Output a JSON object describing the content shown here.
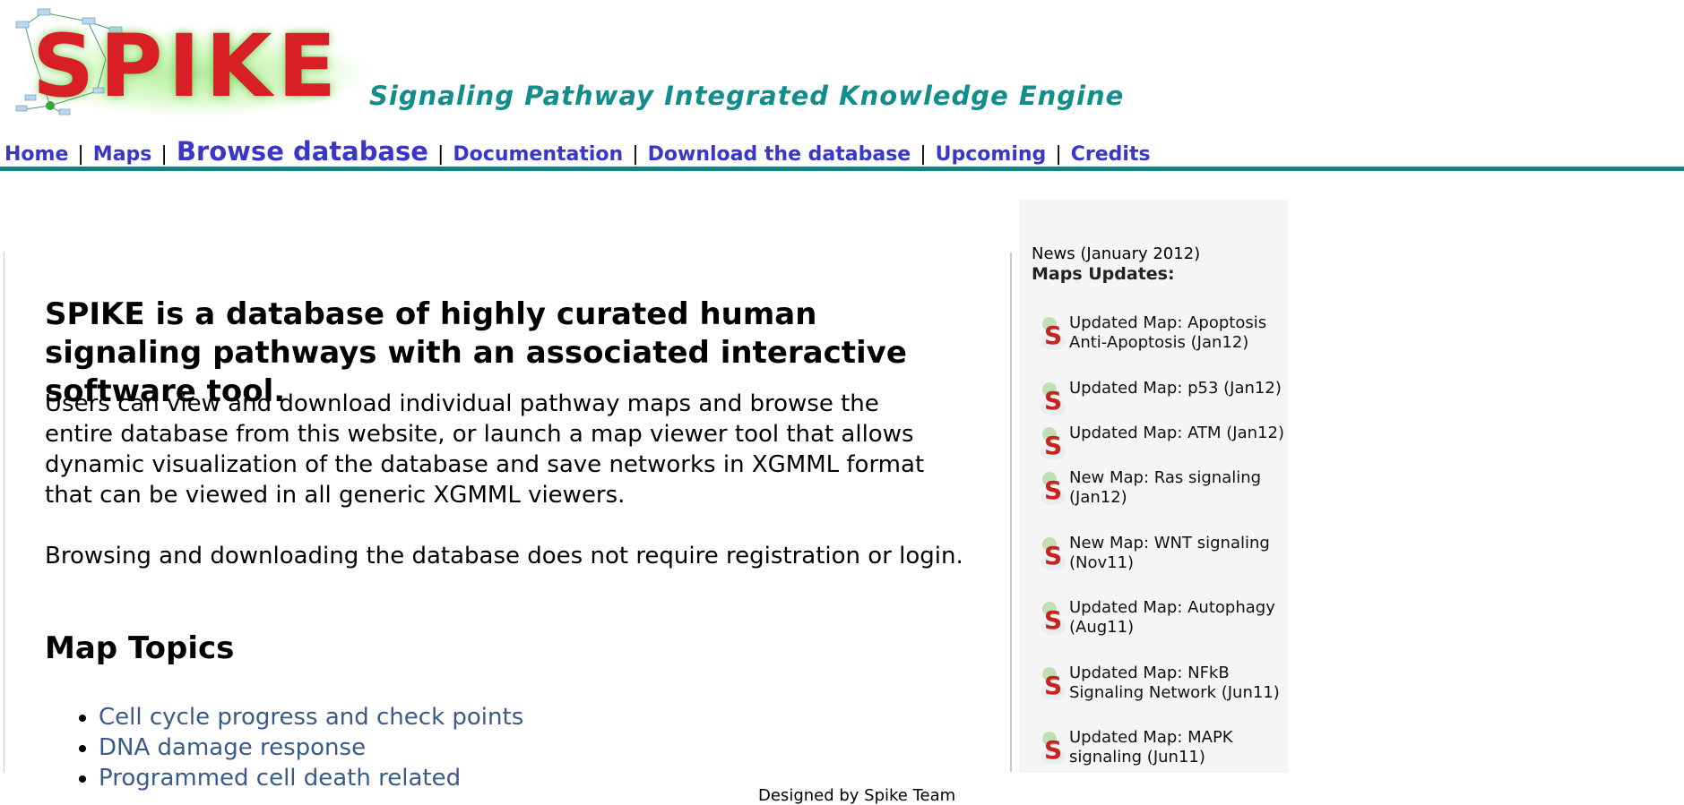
{
  "header": {
    "logo_text": "SPIKE",
    "tagline": "Signaling Pathway Integrated Knowledge Engine"
  },
  "nav": {
    "separator": "|",
    "items": [
      {
        "label": "Home"
      },
      {
        "label": "Maps"
      },
      {
        "label": "Browse database"
      },
      {
        "label": "Documentation"
      },
      {
        "label": "Download the database"
      },
      {
        "label": "Upcoming"
      },
      {
        "label": "Credits"
      }
    ]
  },
  "main": {
    "headline": "SPIKE is a database of highly curated human signaling pathways with an associated interactive software tool.",
    "intro": "Users can view and download individual pathway maps and browse the entire database from this website, or launch a map viewer tool that allows dynamic visualization of the database and save networks in XGMML format that can be viewed in all generic XGMML viewers.",
    "note": "Browsing and downloading the database does not require registration or login.",
    "topics_title": "Map Topics",
    "topics": [
      {
        "label": "Cell cycle progress and check points"
      },
      {
        "label": "DNA damage response"
      },
      {
        "label": "Programmed cell death related"
      }
    ]
  },
  "news": {
    "date_label": "News (January 2012)",
    "title": "Maps Updates:",
    "items": [
      {
        "text": "Updated Map: Apoptosis Anti-Apoptosis (Jan12)"
      },
      {
        "text": "Updated Map: p53 (Jan12)"
      },
      {
        "text": "Updated Map: ATM (Jan12)"
      },
      {
        "text": "New Map: Ras signaling (Jan12)"
      },
      {
        "text": "New Map: WNT signaling (Nov11)"
      },
      {
        "text": "Updated Map: Autophagy (Aug11)"
      },
      {
        "text": "Updated Map: NFkB Signaling Network (Jun11)"
      },
      {
        "text": "Updated Map: MAPK signaling (Jun11)"
      }
    ]
  },
  "footer": {
    "text": "Designed by Spike Team"
  },
  "colors": {
    "logo_red": "#d81f26",
    "tagline_teal": "#138c8c",
    "nav_link": "#3a36c9",
    "rule_teal": "#188080",
    "topic_link": "#3a5a88"
  }
}
